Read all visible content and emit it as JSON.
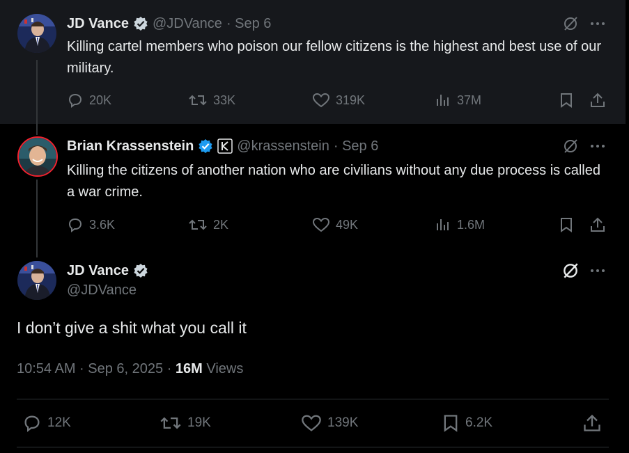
{
  "tweet1": {
    "name": "JD Vance",
    "handle": "@JDVance",
    "date": "· Sep 6",
    "text": "Killing cartel members who poison our fellow citizens is the highest and best use of our military.",
    "replies": "20K",
    "reposts": "33K",
    "likes": "319K",
    "views": "37M"
  },
  "tweet2": {
    "name": "Brian Krassenstein",
    "handle": "@krassenstein",
    "date": "· Sep 6",
    "text": "Killing the citizens of another nation who are civilians without any due process is called a war crime.",
    "replies": "3.6K",
    "reposts": "2K",
    "likes": "49K",
    "views": "1.6M"
  },
  "main": {
    "name": "JD Vance",
    "handle": "@JDVance",
    "text": "I don’t give a shit what you call it",
    "timestamp": "10:54 AM · Sep 6, 2025 · ",
    "views_count": "16M",
    "views_label": " Views",
    "replies": "12K",
    "reposts": "19K",
    "likes": "139K",
    "bookmarks": "6.2K"
  },
  "colors": {
    "background": "#000000",
    "verified": "#1d9bf0",
    "muted": "#71767b",
    "text": "#e7e9ea"
  },
  "icons": [
    "reply-icon",
    "repost-icon",
    "like-icon",
    "views-icon",
    "bookmark-icon",
    "share-icon",
    "grok-icon",
    "more-icon",
    "verified-badge-icon",
    "affiliate-k-icon"
  ]
}
